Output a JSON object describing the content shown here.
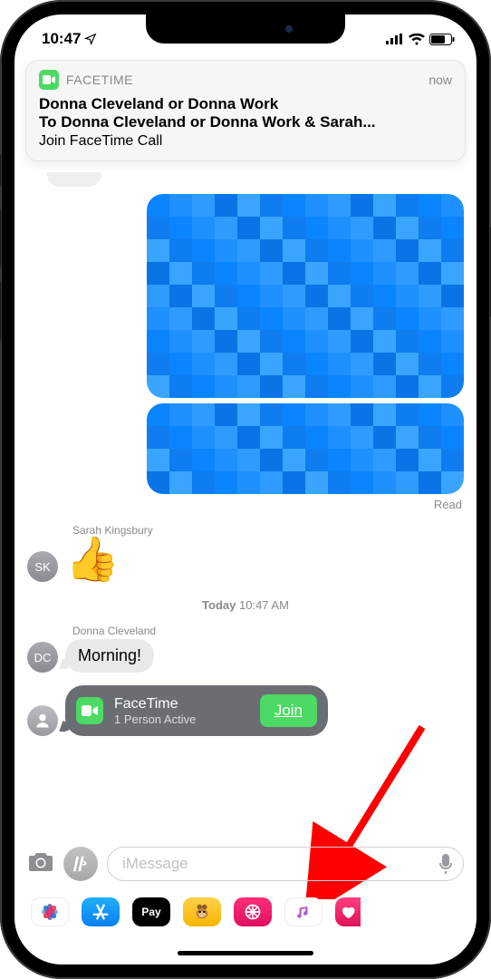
{
  "status": {
    "time": "10:47"
  },
  "notification": {
    "app": "FACETIME",
    "when": "now",
    "title": "Donna Cleveland or Donna Work",
    "subtitle": "To Donna Cleveland or Donna Work & Sarah...",
    "body": "Join FaceTime Call"
  },
  "chat": {
    "read_receipt": "Read",
    "sender1": "Sarah Kingsbury",
    "avatar1_initials": "SK",
    "reaction_emoji": "👍",
    "timestamp_day": "Today",
    "timestamp_time": "10:47 AM",
    "sender2": "Donna Cleveland",
    "avatar2_initials": "DC",
    "message2": "Morning!",
    "facetime_card": {
      "title": "FaceTime",
      "subtitle": "1 Person Active",
      "join": "Join"
    }
  },
  "input": {
    "placeholder": "iMessage"
  },
  "apps": {
    "apple_pay": "Pay"
  }
}
